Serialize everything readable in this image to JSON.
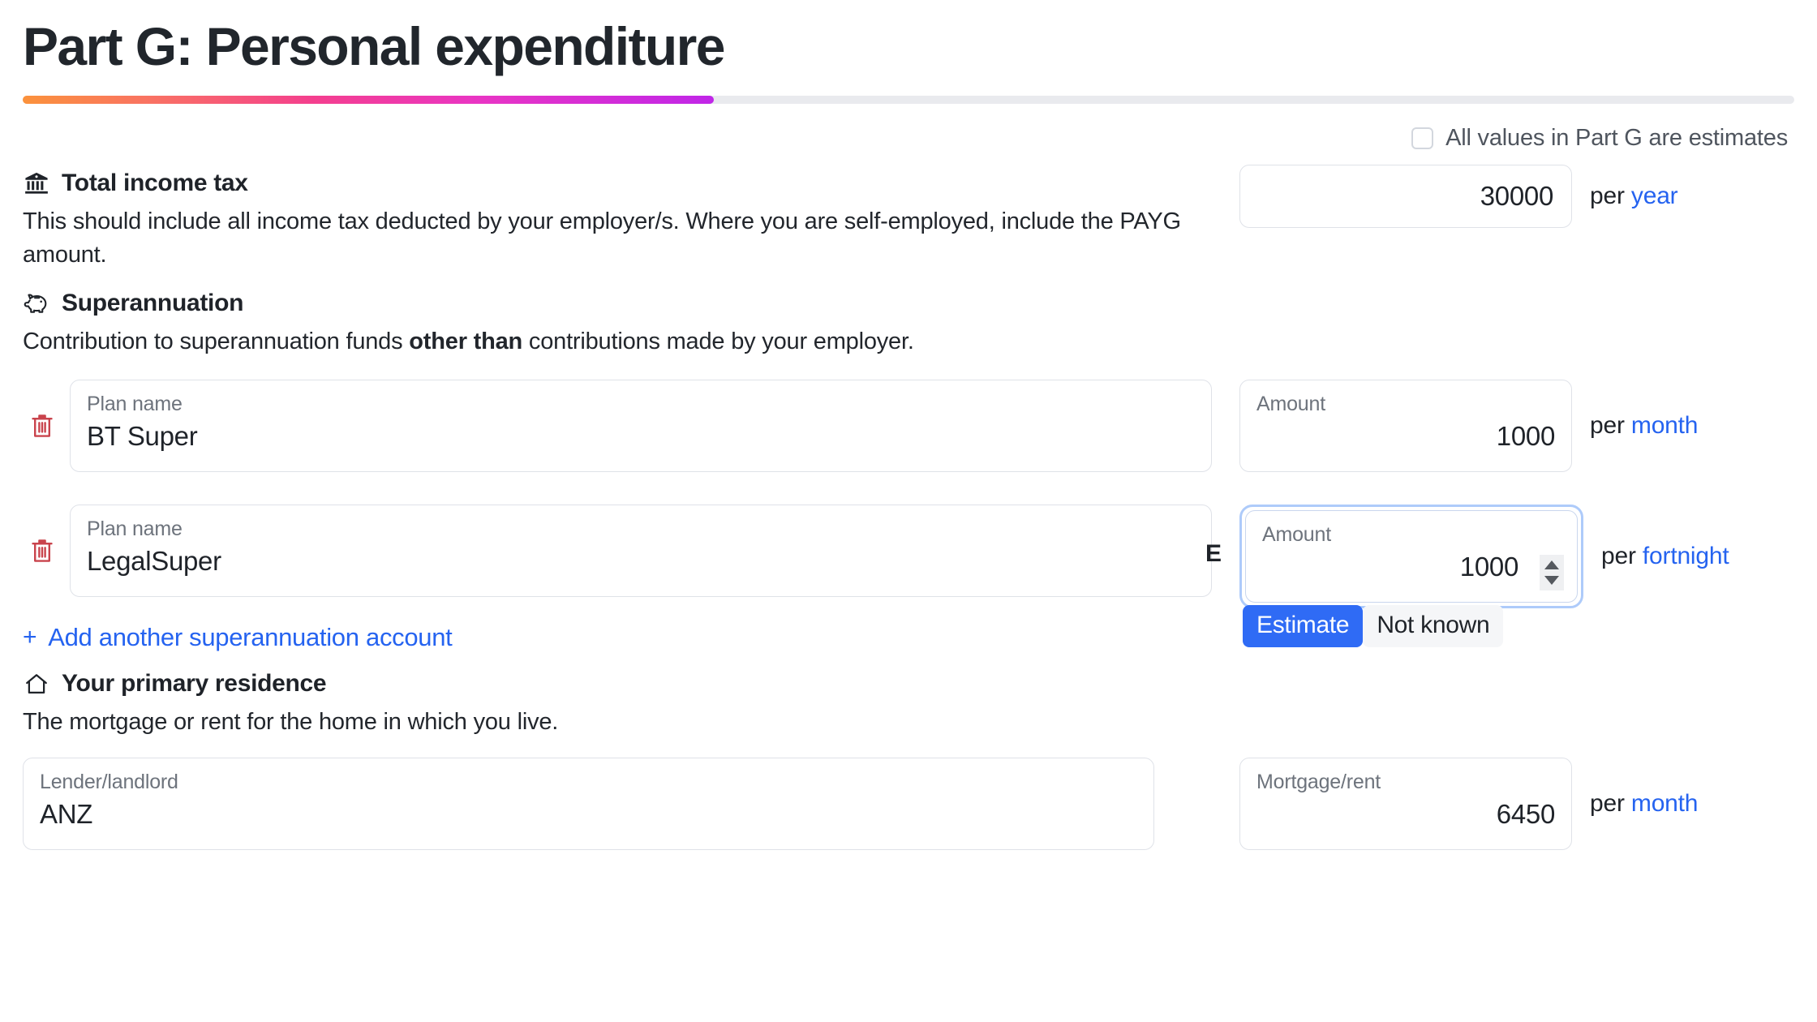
{
  "header": {
    "title": "Part G: Personal expenditure",
    "progress_percent": 39
  },
  "estimates_toggle": {
    "label": "All values in Part G are estimates",
    "checked": false
  },
  "sections": {
    "income_tax": {
      "icon": "bank-icon",
      "title": "Total income tax",
      "description": "This should include all income tax deducted by your employer/s. Where you are self-employed, include the PAYG amount.",
      "amount_value": "30000",
      "per_label": "per",
      "frequency": "year"
    },
    "superannuation": {
      "icon": "piggy-bank-icon",
      "title": "Superannuation",
      "description_before": "Contribution to superannuation funds ",
      "description_bold": "other than",
      "description_after": " contributions made by your employer.",
      "plan_label": "Plan name",
      "amount_label": "Amount",
      "per_label": "per",
      "accounts": [
        {
          "plan_name": "BT Super",
          "amount": "1000",
          "frequency": "month",
          "focused": false
        },
        {
          "plan_name": "LegalSuper",
          "amount": "1000",
          "frequency": "fortnight",
          "focused": true
        }
      ],
      "estimate_menu": {
        "partial_label": "E",
        "options": [
          "Estimate",
          "Not known"
        ],
        "selected": "Estimate"
      },
      "add_link": {
        "plus": "+",
        "label": "Add another superannuation account"
      }
    },
    "residence": {
      "icon": "home-icon",
      "title": "Your primary residence",
      "description": "The mortgage or rent for the home in which you live.",
      "lender_label": "Lender/landlord",
      "lender_value": "ANZ",
      "mortgage_label": "Mortgage/rent",
      "mortgage_value": "6450",
      "per_label": "per",
      "frequency": "month"
    }
  },
  "colors": {
    "link_blue": "#2563f0",
    "selected_blue": "#2f6bf5",
    "delete_red": "#c9434c",
    "progress_start": "#fb923c",
    "progress_end": "#c026e8"
  }
}
